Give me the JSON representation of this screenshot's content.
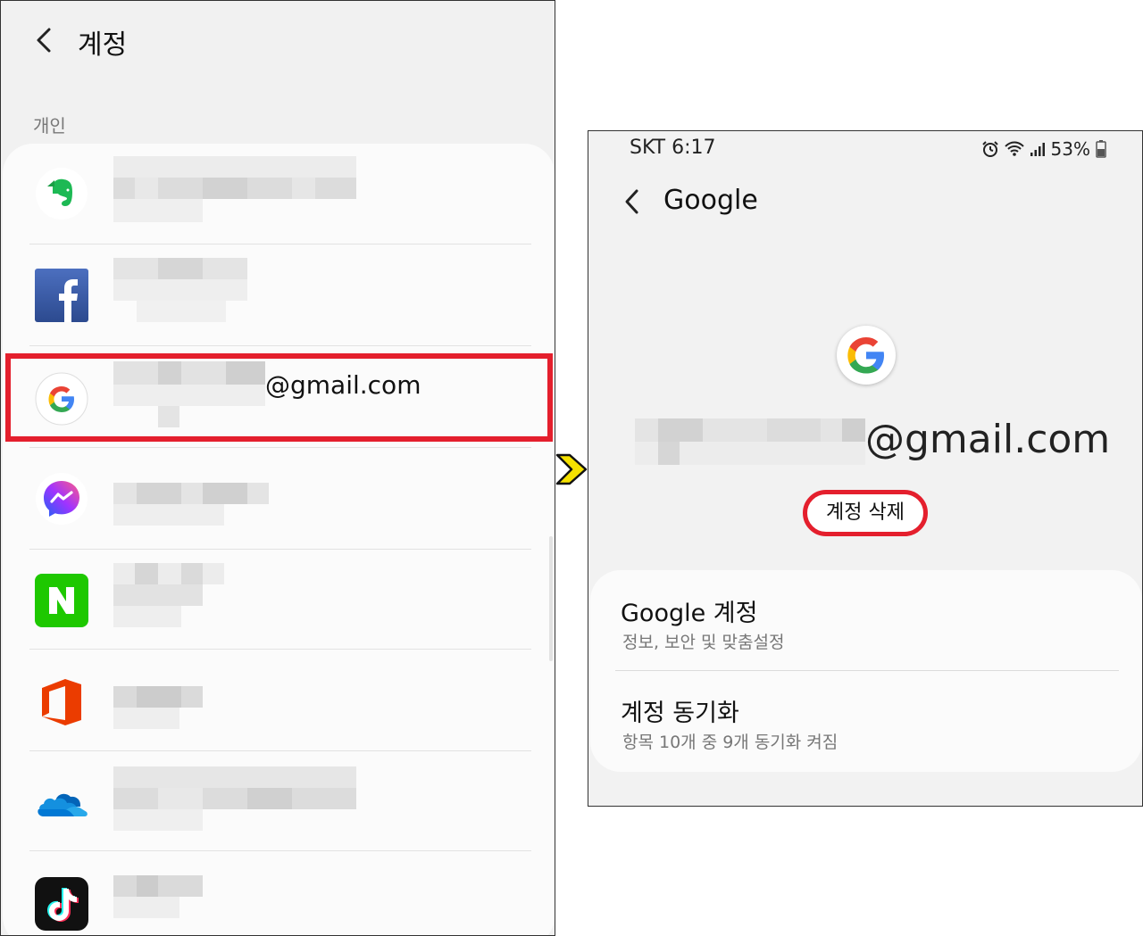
{
  "left_screen": {
    "title": "계정",
    "section_label": "개인",
    "accounts": [
      {
        "icon": "evernote-icon"
      },
      {
        "icon": "facebook-icon"
      },
      {
        "icon": "google-icon",
        "email_suffix": "@gmail.com",
        "highlighted": true
      },
      {
        "icon": "messenger-icon"
      },
      {
        "icon": "naver-icon"
      },
      {
        "icon": "office-icon"
      },
      {
        "icon": "onedrive-icon"
      },
      {
        "icon": "tiktok-icon"
      }
    ]
  },
  "right_screen": {
    "status_bar": {
      "carrier": "SKT",
      "time": "6:17",
      "battery": "53%"
    },
    "title": "Google",
    "email_suffix": "@gmail.com",
    "remove_button": "계정 삭제",
    "settings": [
      {
        "title": "Google 계정",
        "subtitle": "정보, 보안 및 맞춤설정"
      },
      {
        "title": "계정 동기화",
        "subtitle": "항목 10개 중 9개 동기화 켜짐"
      }
    ]
  },
  "colors": {
    "highlight": "#e41f2d",
    "arrow": "#f5e100"
  }
}
